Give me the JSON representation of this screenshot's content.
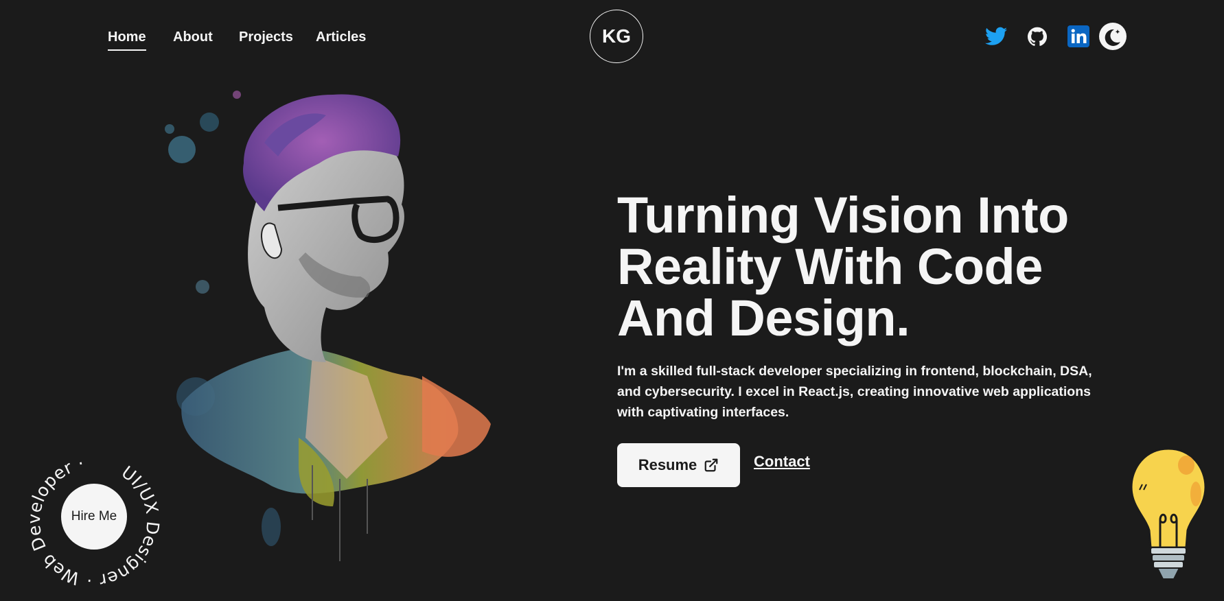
{
  "nav": {
    "items": [
      {
        "label": "Home",
        "active": true
      },
      {
        "label": "About",
        "active": false
      },
      {
        "label": "Projects",
        "active": false
      },
      {
        "label": "Articles",
        "active": false
      }
    ]
  },
  "logo": {
    "text": "KG"
  },
  "social": {
    "icons": [
      "twitter-icon",
      "github-icon",
      "linkedin-icon",
      "moon-icon"
    ],
    "colors": {
      "twitter": "#1da1f2",
      "linkedin": "#0a66c2"
    }
  },
  "hero": {
    "title": "Turning Vision Into Reality With Code And Design.",
    "description": "I'm a skilled full-stack developer specializing in frontend, blockchain, DSA, and cybersecurity. I excel in React.js, creating innovative web applications with captivating interfaces.",
    "resume_label": "Resume",
    "contact_label": "Contact"
  },
  "hire": {
    "label": "Hire Me",
    "ring_text": "UI/UX Designer · Web Developer · "
  },
  "colors": {
    "background": "#1b1b1b",
    "foreground": "#f5f5f5"
  }
}
